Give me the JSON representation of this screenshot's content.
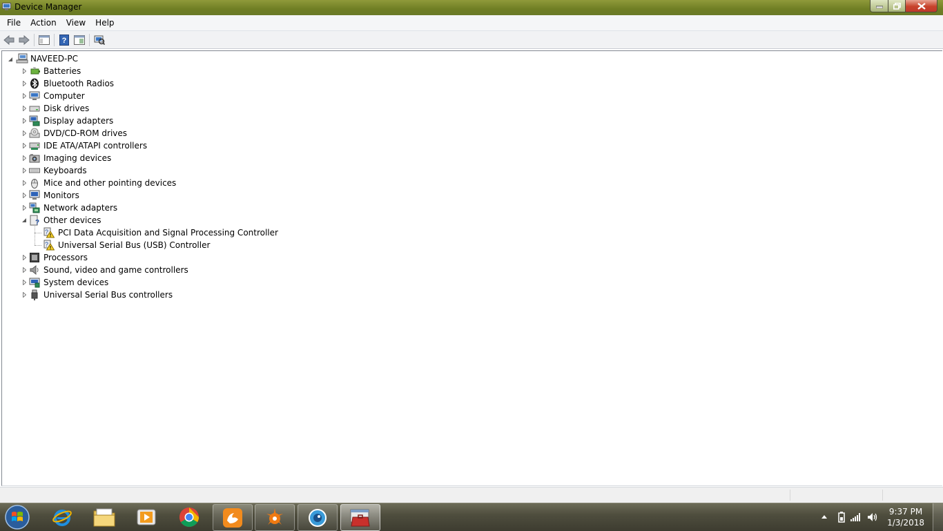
{
  "window": {
    "title": "Device Manager",
    "title_bar_color": "#7a8a2e"
  },
  "menu": [
    "File",
    "Action",
    "View",
    "Help"
  ],
  "tree": {
    "root": "NAVEED-PC",
    "items": [
      {
        "label": "Batteries",
        "icon": "battery-icon",
        "expanded": false
      },
      {
        "label": "Bluetooth Radios",
        "icon": "bluetooth-icon",
        "expanded": false
      },
      {
        "label": "Computer",
        "icon": "computer-icon",
        "expanded": false
      },
      {
        "label": "Disk drives",
        "icon": "disk-drive-icon",
        "expanded": false
      },
      {
        "label": "Display adapters",
        "icon": "display-adapter-icon",
        "expanded": false
      },
      {
        "label": "DVD/CD-ROM drives",
        "icon": "dvd-drive-icon",
        "expanded": false
      },
      {
        "label": "IDE ATA/ATAPI controllers",
        "icon": "ide-controller-icon",
        "expanded": false
      },
      {
        "label": "Imaging devices",
        "icon": "camera-icon",
        "expanded": false
      },
      {
        "label": "Keyboards",
        "icon": "keyboard-icon",
        "expanded": false
      },
      {
        "label": "Mice and other pointing devices",
        "icon": "mouse-icon",
        "expanded": false
      },
      {
        "label": "Monitors",
        "icon": "monitor-icon",
        "expanded": false
      },
      {
        "label": "Network adapters",
        "icon": "network-adapter-icon",
        "expanded": false
      },
      {
        "label": "Other devices",
        "icon": "unknown-device-icon",
        "expanded": true,
        "children": [
          {
            "label": "PCI Data Acquisition and Signal Processing Controller",
            "icon": "warning-device-icon"
          },
          {
            "label": "Universal Serial Bus (USB) Controller",
            "icon": "warning-device-icon"
          }
        ]
      },
      {
        "label": "Processors",
        "icon": "processor-icon",
        "expanded": false
      },
      {
        "label": "Sound, video and game controllers",
        "icon": "speaker-icon",
        "expanded": false
      },
      {
        "label": "System devices",
        "icon": "system-devices-icon",
        "expanded": false
      },
      {
        "label": "Universal Serial Bus controllers",
        "icon": "usb-icon",
        "expanded": false
      }
    ]
  },
  "taskbar": {
    "apps": [
      "start-orb-icon",
      "internet-explorer-icon",
      "file-explorer-icon",
      "media-player-icon",
      "chrome-icon",
      "uc-browser-icon",
      "avast-icon",
      "browser-eye-icon",
      "device-manager-icon"
    ],
    "clock_time": "9:37 PM",
    "clock_date": "1/3/2018"
  }
}
